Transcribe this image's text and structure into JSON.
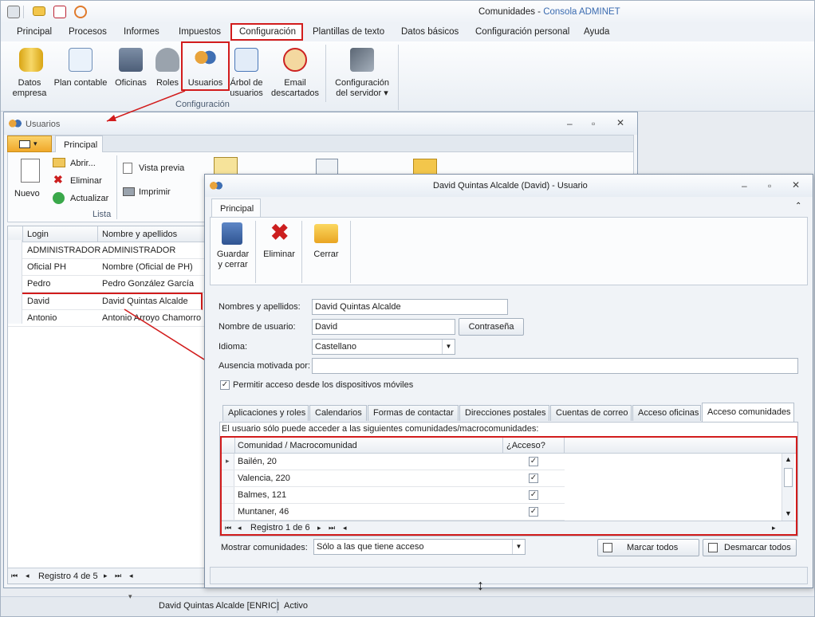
{
  "app": {
    "title_doc": "Comunidades",
    "title_sep": " - ",
    "title_app": "Consola ADMINET"
  },
  "menu": [
    "Principal",
    "Procesos",
    "Informes",
    "Impuestos",
    "Configuración",
    "Plantillas de texto",
    "Datos básicos",
    "Configuración personal",
    "Ayuda"
  ],
  "ribbon": {
    "buttons": [
      {
        "l1": "Datos",
        "l2": "empresa"
      },
      {
        "l1": "Plan contable",
        "l2": ""
      },
      {
        "l1": "Oficinas",
        "l2": ""
      },
      {
        "l1": "Roles",
        "l2": ""
      },
      {
        "l1": "Usuarios",
        "l2": ""
      },
      {
        "l1": "Árbol de",
        "l2": "usuarios"
      },
      {
        "l1": "Email",
        "l2": "descartados"
      },
      {
        "l1": "Configuración",
        "l2": "del servidor ▾"
      }
    ],
    "group": "Configuración"
  },
  "usuarios": {
    "title": "Usuarios",
    "tab": "Principal",
    "nuevo": "Nuevo",
    "abrir": "Abrir...",
    "eliminar": "Eliminar",
    "actualizar": "Actualizar",
    "vista": "Vista previa",
    "imprimir": "Imprimir",
    "group": "Lista",
    "columns": [
      "Login",
      "Nombre y apellidos"
    ],
    "rows": [
      [
        "ADMINISTRADOR",
        "ADMINISTRADOR"
      ],
      [
        "Oficial PH",
        "Nombre (Oficial de PH)"
      ],
      [
        "Pedro",
        "Pedro González García"
      ],
      [
        "David",
        "David Quintas Alcalde"
      ],
      [
        "Antonio",
        "Antonio Arroyo Chamorro"
      ]
    ],
    "nav": "Registro 4 de 5"
  },
  "dialog": {
    "title": "David Quintas Alcalde (David) - Usuario",
    "tab": "Principal",
    "guardar1": "Guardar",
    "guardar2": "y cerrar",
    "eliminar": "Eliminar",
    "cerrar": "Cerrar",
    "lbl_nombre": "Nombres y apellidos:",
    "val_nombre": "David Quintas Alcalde",
    "lbl_usuario": "Nombre de usuario:",
    "val_usuario": "David",
    "btn_pass": "Contraseña",
    "lbl_idioma": "Idioma:",
    "val_idioma": "Castellano",
    "lbl_ausencia": "Ausencia motivada por:",
    "val_ausencia": "",
    "chk_movil": "Permitir acceso desde los dispositivos móviles",
    "tabs": [
      "Aplicaciones y roles",
      "Calendarios",
      "Formas de contactar",
      "Direcciones postales",
      "Cuentas de correo",
      "Acceso oficinas",
      "Acceso comunidades"
    ],
    "info": "El usuario sólo puede acceder a las siguientes comunidades/macrocomunidades:",
    "col_com": "Comunidad / Macrocomunidad",
    "col_acc": "¿Acceso?",
    "rows": [
      "Bailén, 20",
      "Valencia, 220",
      "Balmes, 121",
      "Muntaner, 46"
    ],
    "nav": "Registro 1 de 6",
    "lbl_mostrar": "Mostrar comunidades:",
    "val_mostrar": "Sólo a las que tiene acceso",
    "marcar": "Marcar todos",
    "desmarcar": "Desmarcar todos"
  },
  "status": {
    "user": "David Quintas Alcalde [ENRIC]",
    "state": "Activo"
  },
  "colors": {
    "highlight": "#d21c1c",
    "accent": "#f7c55a"
  }
}
